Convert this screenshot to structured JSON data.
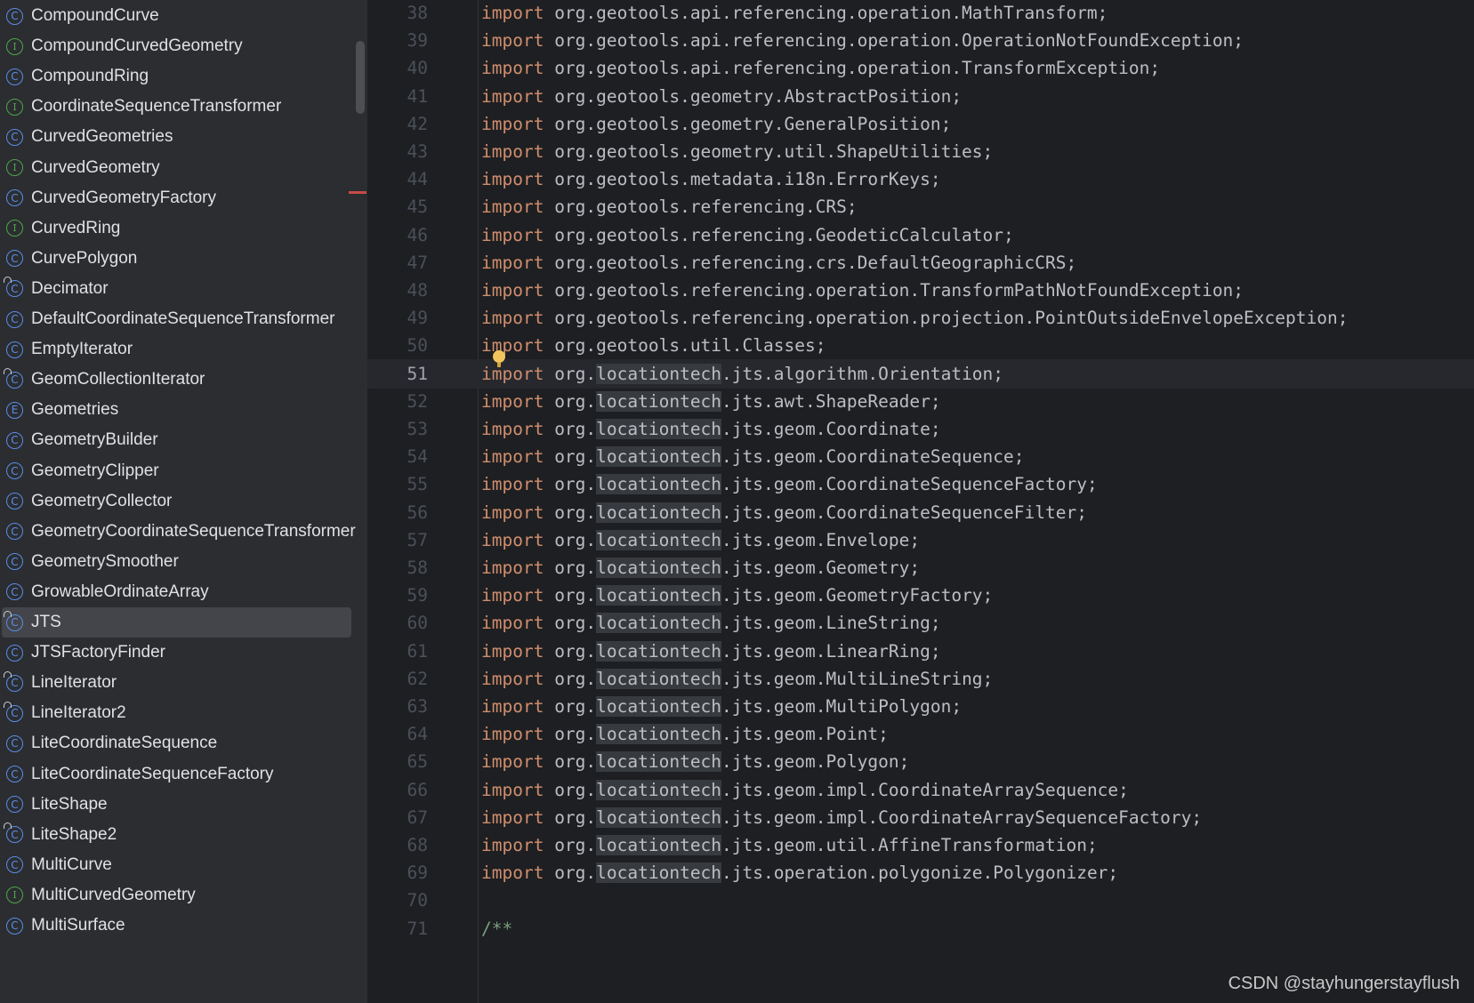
{
  "sidebar": {
    "items": [
      {
        "label": "CompoundCurve",
        "kind": "class",
        "icon": "class-icon"
      },
      {
        "label": "CompoundCurvedGeometry",
        "kind": "interface",
        "icon": "interface-icon"
      },
      {
        "label": "CompoundRing",
        "kind": "class",
        "icon": "class-icon"
      },
      {
        "label": "CoordinateSequenceTransformer",
        "kind": "interface",
        "icon": "interface-icon"
      },
      {
        "label": "CurvedGeometries",
        "kind": "class",
        "icon": "class-icon"
      },
      {
        "label": "CurvedGeometry",
        "kind": "interface",
        "icon": "interface-icon"
      },
      {
        "label": "CurvedGeometryFactory",
        "kind": "class",
        "icon": "class-icon"
      },
      {
        "label": "CurvedRing",
        "kind": "interface",
        "icon": "interface-icon"
      },
      {
        "label": "CurvePolygon",
        "kind": "class",
        "icon": "class-icon"
      },
      {
        "label": "Decimator",
        "kind": "class-locked",
        "icon": "locked-class-icon"
      },
      {
        "label": "DefaultCoordinateSequenceTransformer",
        "kind": "class",
        "icon": "class-icon"
      },
      {
        "label": "EmptyIterator",
        "kind": "class",
        "icon": "class-icon"
      },
      {
        "label": "GeomCollectionIterator",
        "kind": "class-locked",
        "icon": "locked-class-icon"
      },
      {
        "label": "Geometries",
        "kind": "enum",
        "icon": "enum-icon"
      },
      {
        "label": "GeometryBuilder",
        "kind": "class",
        "icon": "class-icon"
      },
      {
        "label": "GeometryClipper",
        "kind": "class",
        "icon": "class-icon"
      },
      {
        "label": "GeometryCollector",
        "kind": "class",
        "icon": "class-icon"
      },
      {
        "label": "GeometryCoordinateSequenceTransformer",
        "kind": "class",
        "icon": "class-icon"
      },
      {
        "label": "GeometrySmoother",
        "kind": "class",
        "icon": "class-icon"
      },
      {
        "label": "GrowableOrdinateArray",
        "kind": "class",
        "icon": "class-icon"
      },
      {
        "label": "JTS",
        "kind": "class-locked",
        "icon": "locked-class-icon",
        "selected": true
      },
      {
        "label": "JTSFactoryFinder",
        "kind": "class",
        "icon": "class-icon"
      },
      {
        "label": "LineIterator",
        "kind": "class-locked",
        "icon": "locked-class-icon"
      },
      {
        "label": "LineIterator2",
        "kind": "class-locked",
        "icon": "locked-class-icon"
      },
      {
        "label": "LiteCoordinateSequence",
        "kind": "class",
        "icon": "class-icon"
      },
      {
        "label": "LiteCoordinateSequenceFactory",
        "kind": "class",
        "icon": "class-icon"
      },
      {
        "label": "LiteShape",
        "kind": "class",
        "icon": "class-icon"
      },
      {
        "label": "LiteShape2",
        "kind": "class-locked",
        "icon": "locked-class-icon"
      },
      {
        "label": "MultiCurve",
        "kind": "class",
        "icon": "class-icon"
      },
      {
        "label": "MultiCurvedGeometry",
        "kind": "interface",
        "icon": "interface-icon"
      },
      {
        "label": "MultiSurface",
        "kind": "class",
        "icon": "class-icon"
      }
    ],
    "icon_letters": {
      "class": "C",
      "interface": "I",
      "enum": "E"
    }
  },
  "editor": {
    "current_line": 51,
    "lines": [
      {
        "n": "38",
        "kw": "import",
        "text": " org.geotools.api.referencing.operation.MathTransform;"
      },
      {
        "n": "39",
        "kw": "import",
        "text": " org.geotools.api.referencing.operation.OperationNotFoundException;"
      },
      {
        "n": "40",
        "kw": "import",
        "text": " org.geotools.api.referencing.operation.TransformException;"
      },
      {
        "n": "41",
        "kw": "import",
        "text": " org.geotools.geometry.AbstractPosition;"
      },
      {
        "n": "42",
        "kw": "import",
        "text": " org.geotools.geometry.GeneralPosition;"
      },
      {
        "n": "43",
        "kw": "import",
        "text": " org.geotools.geometry.util.ShapeUtilities;"
      },
      {
        "n": "44",
        "kw": "import",
        "text": " org.geotools.metadata.i18n.ErrorKeys;"
      },
      {
        "n": "45",
        "kw": "import",
        "text": " org.geotools.referencing.CRS;"
      },
      {
        "n": "46",
        "kw": "import",
        "text": " org.geotools.referencing.GeodeticCalculator;"
      },
      {
        "n": "47",
        "kw": "import",
        "text": " org.geotools.referencing.crs.DefaultGeographicCRS;"
      },
      {
        "n": "48",
        "kw": "import",
        "text": " org.geotools.referencing.operation.TransformPathNotFoundException;"
      },
      {
        "n": "49",
        "kw": "import",
        "text": " org.geotools.referencing.operation.projection.PointOutsideEnvelopeException;"
      },
      {
        "n": "50",
        "kw": "import",
        "text": " org.geotools.util.Classes;"
      },
      {
        "n": "51",
        "kw": "import",
        "pre": " org.",
        "hl": "locationtech",
        "text": ".jts.algorithm.Orientation;"
      },
      {
        "n": "52",
        "kw": "import",
        "pre": " org.",
        "hl": "locationtech",
        "text": ".jts.awt.ShapeReader;"
      },
      {
        "n": "53",
        "kw": "import",
        "pre": " org.",
        "hl": "locationtech",
        "text": ".jts.geom.Coordinate;"
      },
      {
        "n": "54",
        "kw": "import",
        "pre": " org.",
        "hl": "locationtech",
        "text": ".jts.geom.CoordinateSequence;"
      },
      {
        "n": "55",
        "kw": "import",
        "pre": " org.",
        "hl": "locationtech",
        "text": ".jts.geom.CoordinateSequenceFactory;"
      },
      {
        "n": "56",
        "kw": "import",
        "pre": " org.",
        "hl": "locationtech",
        "text": ".jts.geom.CoordinateSequenceFilter;"
      },
      {
        "n": "57",
        "kw": "import",
        "pre": " org.",
        "hl": "locationtech",
        "text": ".jts.geom.Envelope;"
      },
      {
        "n": "58",
        "kw": "import",
        "pre": " org.",
        "hl": "locationtech",
        "text": ".jts.geom.Geometry;"
      },
      {
        "n": "59",
        "kw": "import",
        "pre": " org.",
        "hl": "locationtech",
        "text": ".jts.geom.GeometryFactory;"
      },
      {
        "n": "60",
        "kw": "import",
        "pre": " org.",
        "hl": "locationtech",
        "text": ".jts.geom.LineString;"
      },
      {
        "n": "61",
        "kw": "import",
        "pre": " org.",
        "hl": "locationtech",
        "text": ".jts.geom.LinearRing;"
      },
      {
        "n": "62",
        "kw": "import",
        "pre": " org.",
        "hl": "locationtech",
        "text": ".jts.geom.MultiLineString;"
      },
      {
        "n": "63",
        "kw": "import",
        "pre": " org.",
        "hl": "locationtech",
        "text": ".jts.geom.MultiPolygon;"
      },
      {
        "n": "64",
        "kw": "import",
        "pre": " org.",
        "hl": "locationtech",
        "text": ".jts.geom.Point;"
      },
      {
        "n": "65",
        "kw": "import",
        "pre": " org.",
        "hl": "locationtech",
        "text": ".jts.geom.Polygon;"
      },
      {
        "n": "66",
        "kw": "import",
        "pre": " org.",
        "hl": "locationtech",
        "text": ".jts.geom.impl.CoordinateArraySequence;"
      },
      {
        "n": "67",
        "kw": "import",
        "pre": " org.",
        "hl": "locationtech",
        "text": ".jts.geom.impl.CoordinateArraySequenceFactory;"
      },
      {
        "n": "68",
        "kw": "import",
        "pre": " org.",
        "hl": "locationtech",
        "text": ".jts.geom.util.AffineTransformation;"
      },
      {
        "n": "69",
        "kw": "import",
        "pre": " org.",
        "hl": "locationtech",
        "text": ".jts.operation.polygonize.Polygonizer;"
      },
      {
        "n": "70",
        "text": ""
      },
      {
        "n": "71",
        "comment": "/**"
      }
    ]
  },
  "watermark": "CSDN @stayhungerstayflush",
  "colors": {
    "keyword": "#cf8e6d",
    "class_icon": "#5a8de8",
    "interface_icon": "#4fa64b",
    "sidebar_bg": "#2b2d30",
    "editor_bg": "#1e1f22"
  }
}
